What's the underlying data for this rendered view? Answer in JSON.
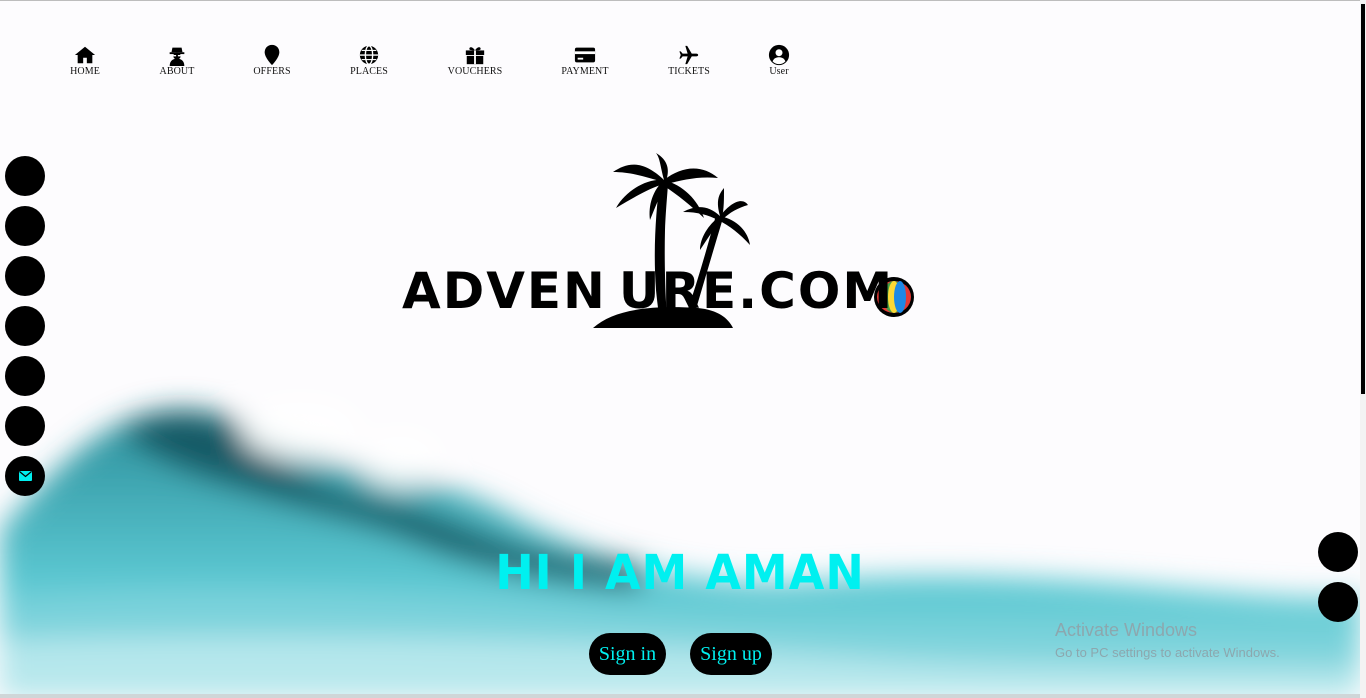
{
  "nav": {
    "items": [
      {
        "label": "HOME",
        "icon": "home-icon"
      },
      {
        "label": "ABOUT",
        "icon": "user-secret-icon"
      },
      {
        "label": "OFFERS",
        "icon": "map-pin-icon"
      },
      {
        "label": "PLACES",
        "icon": "globe-icon"
      },
      {
        "label": "VOUCHERS",
        "icon": "gift-icon"
      },
      {
        "label": "PAYMENT",
        "icon": "credit-card-icon"
      },
      {
        "label": "TICKETS",
        "icon": "plane-icon"
      },
      {
        "label": "User",
        "icon": "user-circle-icon"
      }
    ]
  },
  "logo": {
    "text": "ADVEN URE.COM"
  },
  "hero": {
    "greeting": "HI I AM AMAN"
  },
  "auth": {
    "sign_in": "Sign in",
    "sign_up": "Sign up"
  },
  "watermark": {
    "line1": "Activate Windows",
    "line2": "Go to PC settings to activate Windows."
  },
  "colors": {
    "accent": "#00f0f0",
    "button_bg": "#000000",
    "wave": "#1a9aa8"
  }
}
